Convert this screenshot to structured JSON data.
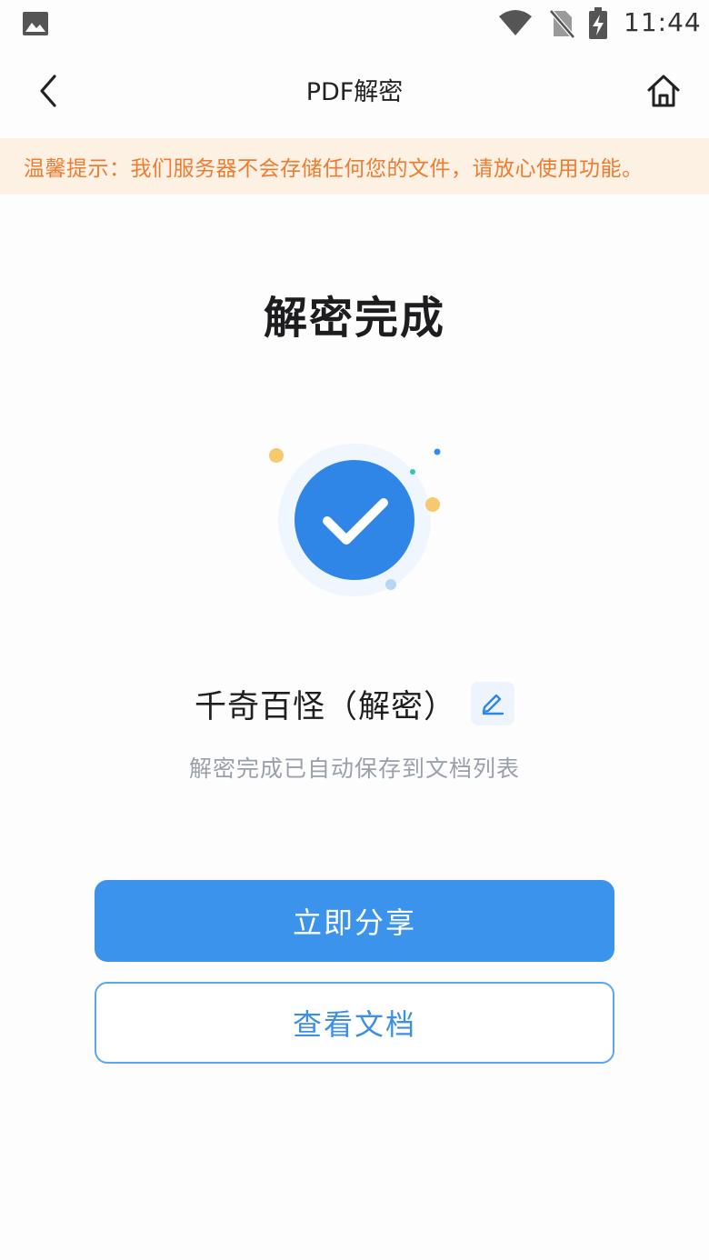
{
  "status_bar": {
    "time": "11:44",
    "icons": [
      "gallery-icon",
      "wifi-icon",
      "no-sim-icon",
      "battery-charging-icon"
    ]
  },
  "nav": {
    "title": "PDF解密",
    "back_icon": "chevron-left-icon",
    "home_icon": "home-icon"
  },
  "tip": {
    "text": "温馨提示：我们服务器不会存储任何您的文件，请放心使用功能。"
  },
  "result": {
    "title": "解密完成",
    "status_icon": "check-circle-icon",
    "file_name": "千奇百怪（解密）",
    "edit_icon": "pencil-icon",
    "saved_hint": "解密完成已自动保存到文档列表"
  },
  "actions": {
    "share_label": "立即分享",
    "view_label": "查看文档"
  },
  "colors": {
    "accent": "#3b93ec",
    "tip_background": "#fdf1e4",
    "tip_text": "#ec7c32",
    "hint_text": "#9aa0aa",
    "confetti_yellow": "#f8c870",
    "confetti_teal": "#35c3b8"
  }
}
